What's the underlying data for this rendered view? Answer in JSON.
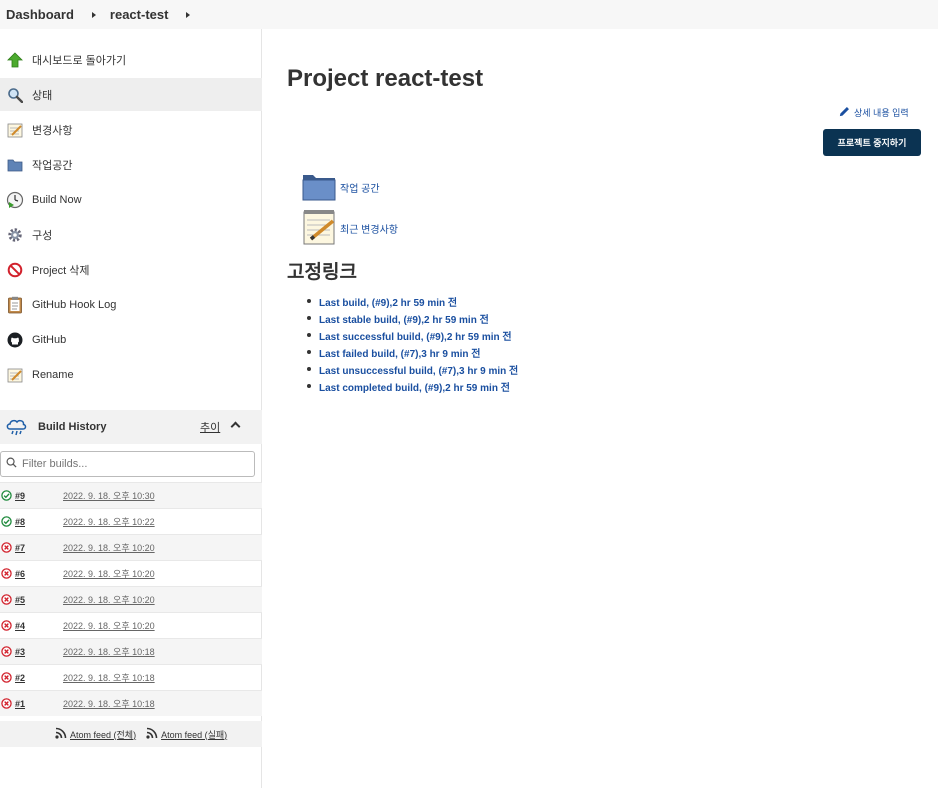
{
  "breadcrumb": {
    "items": [
      "Dashboard",
      "react-test"
    ]
  },
  "sidebar": {
    "tasks": [
      {
        "label": "대시보드로 돌아가기",
        "icon": "up-arrow-icon"
      },
      {
        "label": "상태",
        "icon": "magnifier-icon"
      },
      {
        "label": "변경사항",
        "icon": "notepad-icon"
      },
      {
        "label": "작업공간",
        "icon": "folder-icon"
      },
      {
        "label": "Build Now",
        "icon": "clock-play-icon"
      },
      {
        "label": "구성",
        "icon": "gear-icon"
      },
      {
        "label": "Project 삭제",
        "icon": "no-entry-icon"
      },
      {
        "label": "GitHub Hook Log",
        "icon": "clipboard-icon"
      },
      {
        "label": "GitHub",
        "icon": "github-icon"
      },
      {
        "label": "Rename",
        "icon": "notepad-icon"
      }
    ],
    "active_task": "상태"
  },
  "build_history": {
    "title": "Build History",
    "trend_label": "추이",
    "filter_placeholder": "Filter builds...",
    "builds": [
      {
        "number": "#9",
        "date": "2022. 9. 18. 오후 10:30",
        "status": "success"
      },
      {
        "number": "#8",
        "date": "2022. 9. 18. 오후 10:22",
        "status": "success"
      },
      {
        "number": "#7",
        "date": "2022. 9. 18. 오후 10:20",
        "status": "failed"
      },
      {
        "number": "#6",
        "date": "2022. 9. 18. 오후 10:20",
        "status": "failed"
      },
      {
        "number": "#5",
        "date": "2022. 9. 18. 오후 10:20",
        "status": "failed"
      },
      {
        "number": "#4",
        "date": "2022. 9. 18. 오후 10:20",
        "status": "failed"
      },
      {
        "number": "#3",
        "date": "2022. 9. 18. 오후 10:18",
        "status": "failed"
      },
      {
        "number": "#2",
        "date": "2022. 9. 18. 오후 10:18",
        "status": "failed"
      },
      {
        "number": "#1",
        "date": "2022. 9. 18. 오후 10:18",
        "status": "failed"
      }
    ],
    "feeds": {
      "all": "Atom feed (전체)",
      "failures": "Atom feed (실패)"
    }
  },
  "main": {
    "title": "Project react-test",
    "edit_description": "상세 내용 입력",
    "disable_button": "프로젝트 중지하기",
    "workspace_link": "작업 공간",
    "changes_link": "최근 변경사항",
    "permalinks_title": "고정링크",
    "permalinks": [
      "Last build, (#9),2 hr 59 min 전",
      "Last stable build, (#9),2 hr 59 min 전",
      "Last successful build, (#9),2 hr 59 min 전",
      "Last failed build, (#7),3 hr 9 min 전",
      "Last unsuccessful build, (#7),3 hr 9 min 전",
      "Last completed build, (#9),2 hr 59 min 전"
    ]
  },
  "colors": {
    "link": "#1a4fa0",
    "primary_button": "#0b3352",
    "success": "#1e8a3c",
    "failed": "#d2222d"
  }
}
